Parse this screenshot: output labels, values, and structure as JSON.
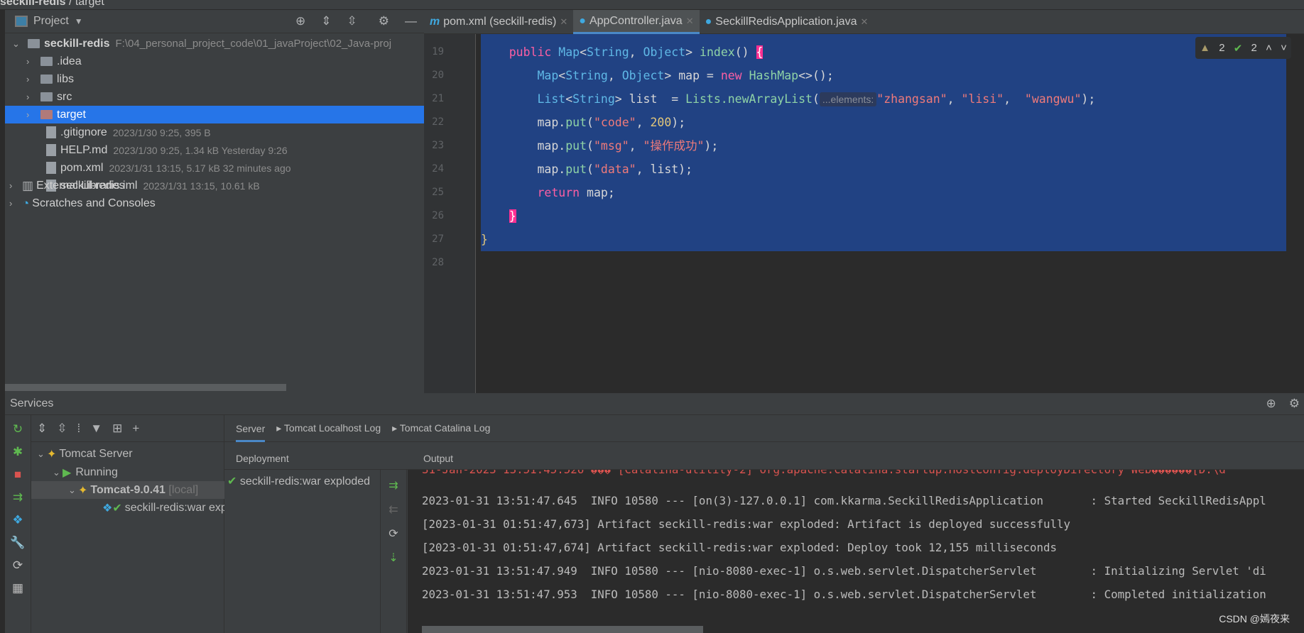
{
  "breadcrumb": [
    "seckill-redis",
    "target"
  ],
  "project": {
    "title": "Project",
    "root": {
      "name": "seckill-redis",
      "path": "F:\\04_personal_project_code\\01_javaProject\\02_Java-proj"
    },
    "items": [
      {
        "name": ".idea",
        "type": "folder"
      },
      {
        "name": "libs",
        "type": "folder"
      },
      {
        "name": "src",
        "type": "folder"
      },
      {
        "name": "target",
        "type": "folder",
        "selected": true
      },
      {
        "name": ".gitignore",
        "meta": "2023/1/30 9:25, 395 B"
      },
      {
        "name": "HELP.md",
        "meta": "2023/1/30 9:25, 1.34 kB Yesterday 9:26"
      },
      {
        "name": "pom.xml",
        "meta": "2023/1/31 13:15, 5.17 kB 32 minutes ago"
      },
      {
        "name": "seckill-redis.iml",
        "meta": "2023/1/31 13:15, 10.61 kB"
      }
    ],
    "extra": [
      "External Libraries",
      "Scratches and Consoles"
    ]
  },
  "editor": {
    "tabs": [
      {
        "label": "pom.xml (seckill-redis)",
        "icon": "maven-icon"
      },
      {
        "label": "AppController.java",
        "icon": "class-icon",
        "active": true
      },
      {
        "label": "SeckillRedisApplication.java",
        "icon": "spring-class-icon"
      }
    ],
    "inspections": {
      "warnings": "2",
      "ok": "2"
    },
    "line_numbers": [
      "19",
      "20",
      "21",
      "22",
      "23",
      "24",
      "25",
      "26",
      "27",
      "28"
    ],
    "lines": [
      [
        [
          "    ",
          "pl"
        ],
        [
          "public ",
          "kw"
        ],
        [
          "Map",
          "ty"
        ],
        [
          "<",
          "pl"
        ],
        [
          "String",
          "ty"
        ],
        [
          ", ",
          "pl"
        ],
        [
          "Object",
          "ty"
        ],
        [
          "> ",
          "pl"
        ],
        [
          "index",
          "fn"
        ],
        [
          "() ",
          "pl"
        ],
        [
          "{",
          "brace"
        ]
      ],
      [
        [
          "        ",
          "pl"
        ],
        [
          "Map",
          "ty"
        ],
        [
          "<",
          "pl"
        ],
        [
          "String",
          "ty"
        ],
        [
          ", ",
          "pl"
        ],
        [
          "Object",
          "ty"
        ],
        [
          "> map = ",
          "pl"
        ],
        [
          "new ",
          "kw"
        ],
        [
          "HashMap",
          "fn"
        ],
        [
          "<>();",
          "pl"
        ]
      ],
      [
        [
          "        ",
          "pl"
        ],
        [
          "List",
          "ty"
        ],
        [
          "<",
          "pl"
        ],
        [
          "String",
          "ty"
        ],
        [
          "> list  = ",
          "pl"
        ],
        [
          "Lists.",
          "fn"
        ],
        [
          "newArrayList",
          "fn"
        ],
        [
          "(",
          "pl"
        ],
        [
          "...elements:",
          "hint"
        ],
        [
          "\"zhangsan\"",
          "st"
        ],
        [
          ", ",
          "pl"
        ],
        [
          "\"lisi\"",
          "st"
        ],
        [
          ",  ",
          "pl"
        ],
        [
          "\"wangwu\"",
          "st"
        ],
        [
          ");",
          "pl"
        ]
      ],
      [
        [
          "        map.",
          "pl"
        ],
        [
          "put",
          "fn"
        ],
        [
          "(",
          "pl"
        ],
        [
          "\"code\"",
          "st"
        ],
        [
          ", ",
          "pl"
        ],
        [
          "200",
          "nu"
        ],
        [
          ");",
          "pl"
        ]
      ],
      [
        [
          "        map.",
          "pl"
        ],
        [
          "put",
          "fn"
        ],
        [
          "(",
          "pl"
        ],
        [
          "\"msg\"",
          "st"
        ],
        [
          ", ",
          "pl"
        ],
        [
          "\"操作成功\"",
          "st"
        ],
        [
          ");",
          "pl"
        ]
      ],
      [
        [
          "        map.",
          "pl"
        ],
        [
          "put",
          "fn"
        ],
        [
          "(",
          "pl"
        ],
        [
          "\"data\"",
          "st"
        ],
        [
          ", list);",
          "pl"
        ]
      ],
      [
        [
          "        ",
          "pl"
        ],
        [
          "return ",
          "kw"
        ],
        [
          "map;",
          "pl"
        ]
      ],
      [
        [
          "    ",
          "pl"
        ],
        [
          "}",
          "brace"
        ]
      ],
      [
        [
          "}",
          "nu"
        ]
      ],
      []
    ]
  },
  "services": {
    "title": "Services",
    "tree": [
      {
        "label": "Tomcat Server"
      },
      {
        "label": "Running"
      },
      {
        "label": "Tomcat-9.0.41",
        "suffix": "[local]"
      },
      {
        "label": "seckill-redis:war exploded"
      }
    ],
    "tabs": [
      "Server",
      "Tomcat Localhost Log",
      "Tomcat Catalina Log"
    ],
    "deployment_header": "Deployment",
    "output_header": "Output",
    "deployment": "seckill-redis:war exploded",
    "log": [
      "31-Jan-2023 13:51:45.526 ��� [Catalina-utility-2] org.apache.catalina.startup.HostConfig.deployDirectory Web������[D:\\d",
      "2023-01-31 13:51:47.645  INFO 10580 --- [on(3)-127.0.0.1] com.kkarma.SeckillRedisApplication       : Started SeckillRedisAppl",
      "[2023-01-31 01:51:47,673] Artifact seckill-redis:war exploded: Artifact is deployed successfully",
      "[2023-01-31 01:51:47,674] Artifact seckill-redis:war exploded: Deploy took 12,155 milliseconds",
      "2023-01-31 13:51:47.949  INFO 10580 --- [nio-8080-exec-1] o.s.web.servlet.DispatcherServlet        : Initializing Servlet 'di",
      "2023-01-31 13:51:47.953  INFO 10580 --- [nio-8080-exec-1] o.s.web.servlet.DispatcherServlet        : Completed initialization"
    ]
  },
  "watermark": "CSDN @嫣夜来",
  "colors": {
    "selection": "#214283",
    "selected_row": "#2675e8",
    "panel": "#3c3f41"
  }
}
